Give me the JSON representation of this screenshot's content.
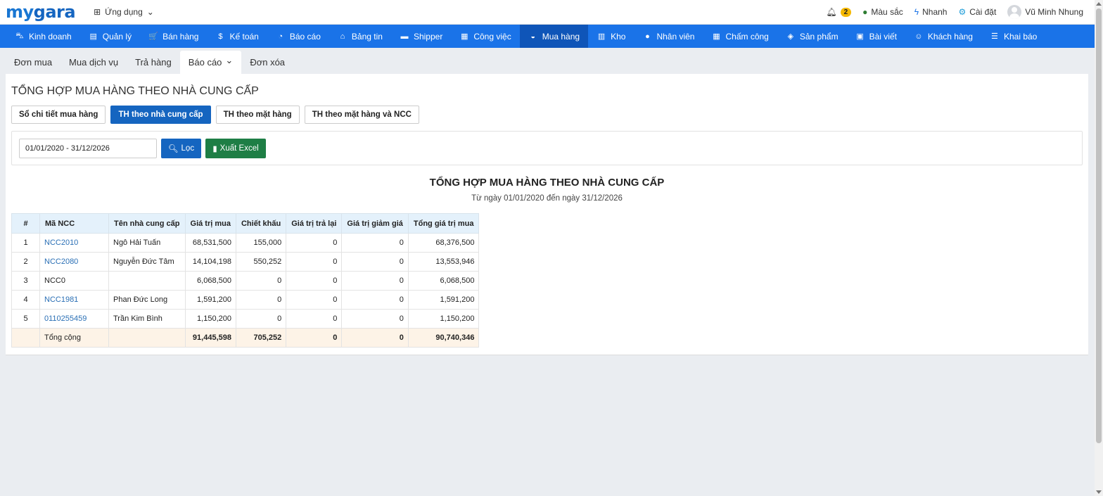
{
  "header": {
    "logo_my": "my",
    "logo_gara": "gara",
    "apps_label": "Ứng dụng",
    "notif_count": "2",
    "color_label": "Màu sắc",
    "quick_label": "Nhanh",
    "settings_label": "Cài đặt",
    "user_name": "Vũ Minh Nhung"
  },
  "nav": [
    {
      "label": "Kinh doanh",
      "icon": "bag-icon",
      "glyph": "⛍"
    },
    {
      "label": "Quản lý",
      "icon": "id-card-icon",
      "glyph": "▤"
    },
    {
      "label": "Bán hàng",
      "icon": "cart-icon",
      "glyph": "🛒"
    },
    {
      "label": "Kế toán",
      "icon": "dollar-icon",
      "glyph": "$"
    },
    {
      "label": "Báo cáo",
      "icon": "pie-chart-icon",
      "glyph": "◔"
    },
    {
      "label": "Bảng tin",
      "icon": "home-icon",
      "glyph": "⌂"
    },
    {
      "label": "Shipper",
      "icon": "truck-icon",
      "glyph": "▬"
    },
    {
      "label": "Công việc",
      "icon": "calendar-icon",
      "glyph": "▦"
    },
    {
      "label": "Mua hàng",
      "icon": "basket-icon",
      "glyph": "◒"
    },
    {
      "label": "Kho",
      "icon": "warehouse-icon",
      "glyph": "▥"
    },
    {
      "label": "Nhân viên",
      "icon": "user-icon",
      "glyph": "●"
    },
    {
      "label": "Chấm công",
      "icon": "calendar-check-icon",
      "glyph": "▦"
    },
    {
      "label": "Sản phẩm",
      "icon": "box-icon",
      "glyph": "◈"
    },
    {
      "label": "Bài viết",
      "icon": "article-icon",
      "glyph": "▣"
    },
    {
      "label": "Khách hàng",
      "icon": "smile-icon",
      "glyph": "☺"
    },
    {
      "label": "Khai báo",
      "icon": "list-icon",
      "glyph": "☰"
    }
  ],
  "active_nav": "Mua hàng",
  "subnav": [
    "Đơn mua",
    "Mua dịch vụ",
    "Trả hàng",
    "Báo cáo",
    "Đơn xóa"
  ],
  "active_subnav": "Báo cáo",
  "page_title": "TỔNG HỢP MUA HÀNG THEO NHÀ CUNG CẤP",
  "report_tabs": [
    "Sổ chi tiết mua hàng",
    "TH theo nhà cung cấp",
    "TH theo mặt hàng",
    "TH theo mặt hàng và NCC"
  ],
  "active_report_tab": "TH theo nhà cung cấp",
  "filter": {
    "date_range": "01/01/2020 - 31/12/2026",
    "filter_button": "Lọc",
    "export_button": "Xuất Excel"
  },
  "report": {
    "title": "TỔNG HỢP MUA HÀNG THEO NHÀ CUNG CẤP",
    "subtitle": "Từ ngày 01/01/2020 đến ngày 31/12/2026"
  },
  "table": {
    "headers": [
      "#",
      "Mã NCC",
      "Tên nhà cung cấp",
      "Giá trị mua",
      "Chiết khấu",
      "Giá trị trả lại",
      "Giá trị giảm giá",
      "Tổng giá trị mua"
    ],
    "rows": [
      [
        "1",
        "NCC2010",
        "Ngô Hải Tuấn",
        "68,531,500",
        "155,000",
        "0",
        "0",
        "68,376,500"
      ],
      [
        "2",
        "NCC2080",
        "Nguyễn Đức Tâm",
        "14,104,198",
        "550,252",
        "0",
        "0",
        "13,553,946"
      ],
      [
        "3",
        "NCC0",
        "",
        "6,068,500",
        "0",
        "0",
        "0",
        "6,068,500"
      ],
      [
        "4",
        "NCC1981",
        "Phan Đức Long",
        "1,591,200",
        "0",
        "0",
        "0",
        "1,591,200"
      ],
      [
        "5",
        "0110255459",
        "Trần Kim Bình",
        "1,150,200",
        "0",
        "0",
        "0",
        "1,150,200"
      ]
    ],
    "linked_codes": [
      "NCC2010",
      "NCC2080",
      "NCC1981",
      "0110255459"
    ],
    "total": [
      "",
      "Tổng cộng",
      "",
      "91,445,598",
      "705,252",
      "0",
      "0",
      "90,740,346"
    ]
  },
  "colors": {
    "nav_bg": "#1a73e8",
    "nav_active": "#0f55b8",
    "primary_button": "#1565c0",
    "excel_button": "#1e7e45",
    "link": "#2a6fb5",
    "table_header": "#e4f1fb",
    "total_row": "#fdf3e7"
  }
}
